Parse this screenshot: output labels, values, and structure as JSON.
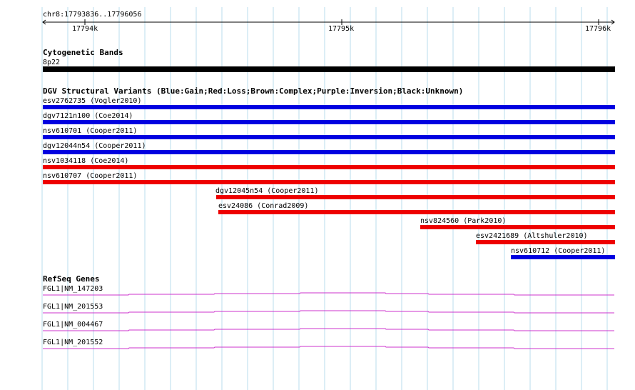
{
  "ruler": {
    "location": "chr8:17793836..17796056",
    "ticks": [
      "17794k",
      "17795k",
      "17796k"
    ]
  },
  "cytoband": {
    "title": "Cytogenetic Bands",
    "band_label": "8p22"
  },
  "dgv": {
    "title": "DGV Structural Variants (Blue:Gain;Red:Loss;Brown:Complex;Purple:Inversion;Black:Unknown)",
    "variants": [
      {
        "label": "esv2762735 (Vogler2010)",
        "type": "gain",
        "color": "#0000e0"
      },
      {
        "label": "dgv7121n100 (Coe2014)",
        "type": "gain",
        "color": "#0000e0"
      },
      {
        "label": "nsv610701 (Cooper2011)",
        "type": "gain",
        "color": "#0000e0"
      },
      {
        "label": "dgv12044n54 (Cooper2011)",
        "type": "gain",
        "color": "#0000e0"
      },
      {
        "label": "nsv1034118 (Coe2014)",
        "type": "loss",
        "color": "#ee0000"
      },
      {
        "label": "nsv610707 (Cooper2011)",
        "type": "loss",
        "color": "#ee0000"
      },
      {
        "label": "dgv12045n54 (Cooper2011)",
        "type": "loss",
        "color": "#ee0000"
      },
      {
        "label": "esv24086 (Conrad2009)",
        "type": "loss",
        "color": "#ee0000"
      },
      {
        "label": "nsv824560 (Park2010)",
        "type": "loss",
        "color": "#ee0000"
      },
      {
        "label": "esv2421689 (Altshuler2010)",
        "type": "loss",
        "color": "#ee0000"
      },
      {
        "label": "nsv610712 (Cooper2011)",
        "type": "gain",
        "color": "#0000e0"
      }
    ]
  },
  "refseq": {
    "title": "RefSeq Genes",
    "gene_color": "#cc33cc",
    "genes": [
      {
        "label": "FGL1|NM_147203"
      },
      {
        "label": "FGL1|NM_201553"
      },
      {
        "label": "FGL1|NM_004467"
      },
      {
        "label": "FGL1|NM_201552"
      }
    ]
  },
  "colors": {
    "grid": "#b8dcec",
    "gain": "#0000e0",
    "loss": "#ee0000",
    "band": "#000000"
  }
}
